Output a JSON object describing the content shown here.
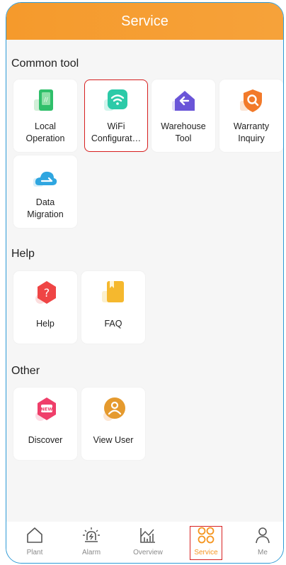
{
  "header": {
    "title": "Service"
  },
  "sections": {
    "common": {
      "title": "Common tool",
      "items": [
        {
          "label_line1": "Local",
          "label_line2": "Operation",
          "icon": "local-operation-icon"
        },
        {
          "label_line1": "WiFi",
          "label_line2": "Configurat…",
          "icon": "wifi-icon"
        },
        {
          "label_line1": "Warehouse",
          "label_line2": "Tool",
          "icon": "warehouse-icon"
        },
        {
          "label_line1": "Warranty",
          "label_line2": "Inquiry",
          "icon": "warranty-search-icon"
        },
        {
          "label_line1": "Data",
          "label_line2": "Migration",
          "icon": "cloud-migration-icon"
        }
      ]
    },
    "help": {
      "title": "Help",
      "items": [
        {
          "label": "Help",
          "icon": "help-question-icon"
        },
        {
          "label": "FAQ",
          "icon": "faq-book-icon"
        }
      ]
    },
    "other": {
      "title": "Other",
      "items": [
        {
          "label": "Discover",
          "icon": "new-badge-icon"
        },
        {
          "label": "View User",
          "icon": "user-icon"
        }
      ]
    }
  },
  "tabbar": {
    "items": [
      {
        "label": "Plant",
        "icon": "home-icon"
      },
      {
        "label": "Alarm",
        "icon": "alarm-icon"
      },
      {
        "label": "Overview",
        "icon": "chart-icon"
      },
      {
        "label": "Service",
        "icon": "service-grid-icon",
        "active": true
      },
      {
        "label": "Me",
        "icon": "person-icon"
      }
    ]
  },
  "colors": {
    "accent": "#f59a2c",
    "highlight": "#d82020"
  }
}
